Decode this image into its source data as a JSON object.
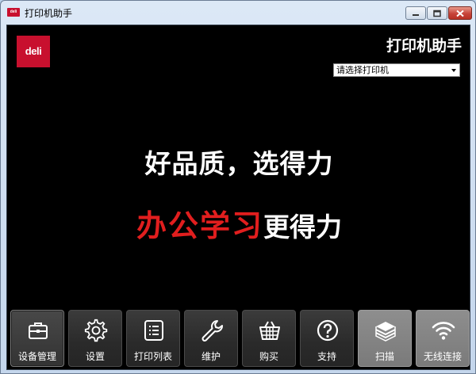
{
  "window": {
    "title": "打印机助手"
  },
  "logo": {
    "text": "deli"
  },
  "header": {
    "title": "打印机助手"
  },
  "printer_select": {
    "value": "请选择打印机"
  },
  "banner": {
    "line1": "好品质，选得力",
    "line2_highlight": "办公学习",
    "line2_rest": "更得力",
    "highlight_color": "#e11e1e"
  },
  "toolbar": {
    "items": [
      {
        "label": "设备管理",
        "icon": "briefcase-icon",
        "state": "active"
      },
      {
        "label": "设置",
        "icon": "gear-icon",
        "state": "normal"
      },
      {
        "label": "打印列表",
        "icon": "list-icon",
        "state": "normal"
      },
      {
        "label": "维护",
        "icon": "wrench-icon",
        "state": "normal"
      },
      {
        "label": "购买",
        "icon": "basket-icon",
        "state": "normal"
      },
      {
        "label": "支持",
        "icon": "help-icon",
        "state": "normal"
      },
      {
        "label": "扫描",
        "icon": "scan-icon",
        "state": "disabled"
      },
      {
        "label": "无线连接",
        "icon": "wifi-icon",
        "state": "disabled"
      }
    ]
  },
  "colors": {
    "brand": "#c8102e",
    "background": "#000000"
  }
}
